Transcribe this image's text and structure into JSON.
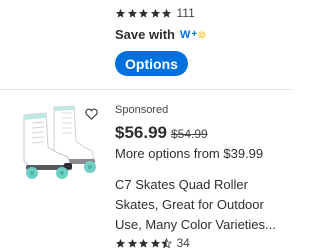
{
  "product_above": {
    "rating_stars": 5,
    "review_count": "111",
    "save_with_label": "Save with",
    "walmart_plus_badge": "W",
    "walmart_plus_suffix": "+",
    "options_button": "Options"
  },
  "product": {
    "sponsored_label": "Sponsored",
    "price": "$56.99",
    "was_price": "$54.99",
    "more_options": "More options from $39.99",
    "title_lines": [
      "C7 Skates Quad Roller",
      "Skates, Great for Outdoor",
      "Use, Many Color Varieties..."
    ],
    "rating_stars": 4.5,
    "review_count": "34",
    "image": "white-quad-roller-skates-mint-wheels"
  },
  "icons": {
    "star": "star-icon",
    "half_star": "half-star-icon",
    "heart": "heart-icon",
    "spark": "spark-icon"
  },
  "colors": {
    "accent": "#0071dc",
    "star": "#2e2f32",
    "text": "#2e2f32",
    "muted": "#46474a",
    "wheel": "#6fd0c3"
  }
}
